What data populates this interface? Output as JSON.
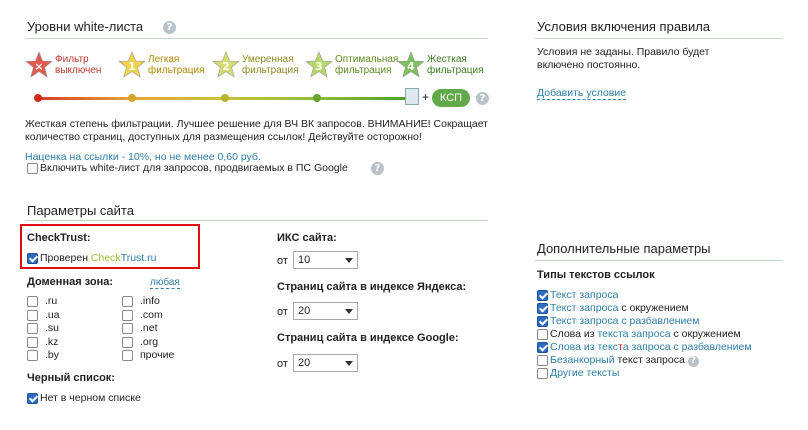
{
  "whitelist": {
    "title": "Уровни white-листа",
    "levels": [
      {
        "label1": "Фильтр",
        "label2": "выключен",
        "mark": "×",
        "color": "#e05a4e",
        "labelColor": "#c0392b"
      },
      {
        "label1": "Легкая",
        "label2": "фильтрация",
        "mark": "1",
        "color": "#f2d24a",
        "labelColor": "#b08a00"
      },
      {
        "label1": "Умеренная",
        "label2": "фильтрация",
        "mark": "2",
        "color": "#d6dc6e",
        "labelColor": "#8a8a20"
      },
      {
        "label1": "Оптимальная",
        "label2": "фильтрация",
        "mark": "3",
        "color": "#b5d86a",
        "labelColor": "#5e8a1a"
      },
      {
        "label1": "Жесткая",
        "label2": "фильтрация",
        "mark": "4",
        "color": "#7fc060",
        "labelColor": "#3a7a1e"
      }
    ],
    "plus": "+",
    "ksp_label": "КСП",
    "description": "Жесткая степень фильтрации. Лучшее решение для ВЧ ВК запросов. ВНИМАНИЕ! Сокращает количество страниц, доступных для размещения ссылок! Действуйте осторожно!",
    "markup_text": "Наценка на ссылки - 10%, но не менее 0,60 руб.",
    "google_checkbox_label": "Включить white-лист для запросов, продвигаемых в ПС Google"
  },
  "conditions": {
    "title": "Условия включения правила",
    "text": "Условия не заданы. Правило будет включено постоянно.",
    "add_link": "Добавить условие"
  },
  "site_params": {
    "title": "Параметры сайта",
    "checktrust_title": "CheckTrust:",
    "checktrust_checkbox": "Проверен ",
    "checktrust_brand_check": "Check",
    "checktrust_brand_trust": "Trust.ru",
    "domain_title": "Доменная зона:",
    "domain_any": "любая",
    "domains_left": [
      ".ru",
      ".ua",
      ".su",
      ".kz",
      ".by"
    ],
    "domains_right": [
      ".info",
      ".com",
      ".net",
      ".org",
      "прочие"
    ],
    "blacklist_title": "Черный список:",
    "blacklist_checkbox": "Нет в черном списке",
    "iks_title": "ИКС сайта:",
    "iks_from": "от",
    "iks_value": "10",
    "yandex_title": "Страниц сайта в индексе Яндекса:",
    "yandex_from": "от",
    "yandex_value": "20",
    "google_title": "Страниц сайта в индексе Google:",
    "google_from": "от",
    "google_value": "20"
  },
  "extra": {
    "title": "Дополнительные параметры",
    "types_title": "Типы текстов ссылок",
    "types": [
      {
        "checked": true,
        "parts": [
          {
            "t": "Текст запроса",
            "c": "link"
          }
        ]
      },
      {
        "checked": true,
        "parts": [
          {
            "t": "Текст запроса",
            "c": "link"
          },
          {
            "t": " с окружением",
            "c": "plain"
          }
        ]
      },
      {
        "checked": true,
        "parts": [
          {
            "t": "Текст запроса с разбавлением",
            "c": "link"
          }
        ]
      },
      {
        "checked": false,
        "parts": [
          {
            "t": "Слова из ",
            "c": "plain"
          },
          {
            "t": "текста запроса",
            "c": "link"
          },
          {
            "t": " с окружением",
            "c": "plain"
          }
        ]
      },
      {
        "checked": true,
        "parts": [
          {
            "t": "Слова из текс",
            "c": "link"
          },
          {
            "t": "т",
            "c": "red"
          },
          {
            "t": "а запроса с разбавлением",
            "c": "link"
          }
        ]
      },
      {
        "checked": false,
        "parts": [
          {
            "t": "Безанкорный",
            "c": "link"
          },
          {
            "t": " текст запроса",
            "c": "plain"
          }
        ],
        "help": true
      },
      {
        "checked": false,
        "parts": [
          {
            "t": "Другие тексты",
            "c": "link"
          }
        ]
      }
    ]
  },
  "colors": {
    "accent": "#2c7fa8",
    "green": "#62a94a",
    "highlight": "#e01010"
  }
}
